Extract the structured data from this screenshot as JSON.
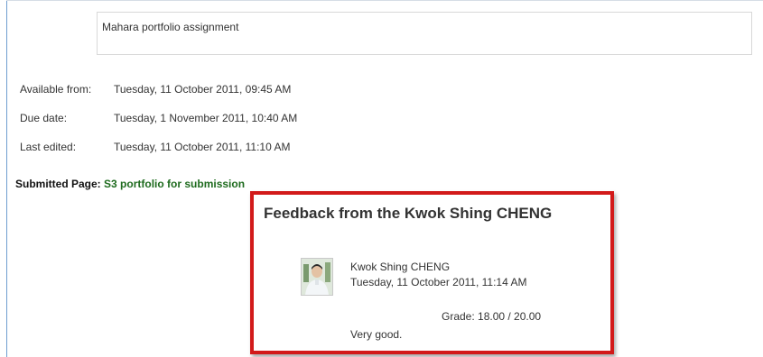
{
  "assignment": {
    "description": "Mahara portfolio assignment"
  },
  "info": [
    {
      "label": "Available from:",
      "value": "Tuesday, 11 October 2011, 09:45 AM"
    },
    {
      "label": "Due date:",
      "value": "Tuesday, 1 November 2011, 10:40 AM"
    },
    {
      "label": "Last edited:",
      "value": "Tuesday, 11 October 2011, 11:10 AM"
    }
  ],
  "submission": {
    "label": "Submitted Page:",
    "page_link": "S3 portfolio for submission"
  },
  "feedback": {
    "title": "Feedback from the Kwok Shing CHENG",
    "author": "Kwok Shing CHENG",
    "date": "Tuesday, 11 October 2011, 11:14 AM",
    "grade": "Grade: 18.00 / 20.00",
    "comment": "Very good."
  },
  "colors": {
    "highlight_border": "#d21a1a",
    "link": "#1e6b1e",
    "frame": "#6f9ed0"
  }
}
